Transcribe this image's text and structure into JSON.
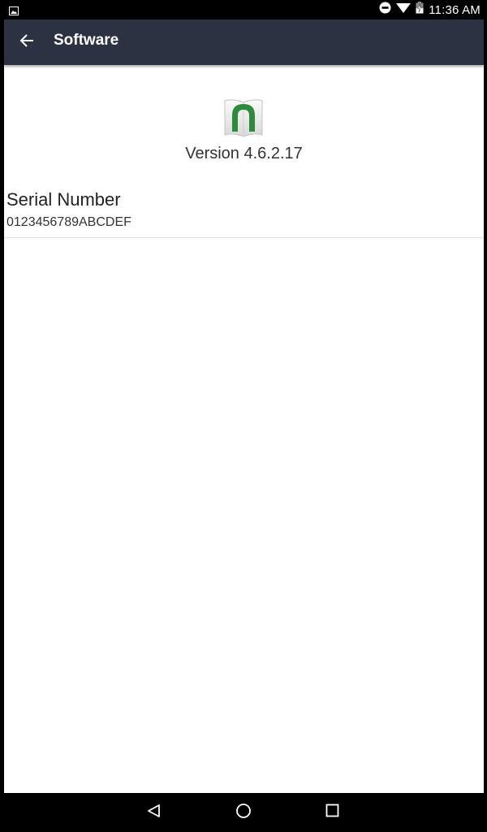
{
  "status_bar": {
    "time": "11:36 AM",
    "icons": [
      "gallery-icon",
      "do-not-disturb-icon",
      "wifi-icon",
      "battery-charging-icon"
    ]
  },
  "app_bar": {
    "title": "Software",
    "back_icon": "arrow-back-icon",
    "background_color": "#2d3243"
  },
  "about": {
    "logo_icon": "nook-app-logo-icon",
    "logo_color": "#2e8b3e",
    "version": "Version 4.6.2.17"
  },
  "serial": {
    "label": "Serial Number",
    "value": "0123456789ABCDEF"
  },
  "nav_bar": {
    "buttons": [
      "nav-back-icon",
      "nav-home-icon",
      "nav-recents-icon"
    ]
  }
}
